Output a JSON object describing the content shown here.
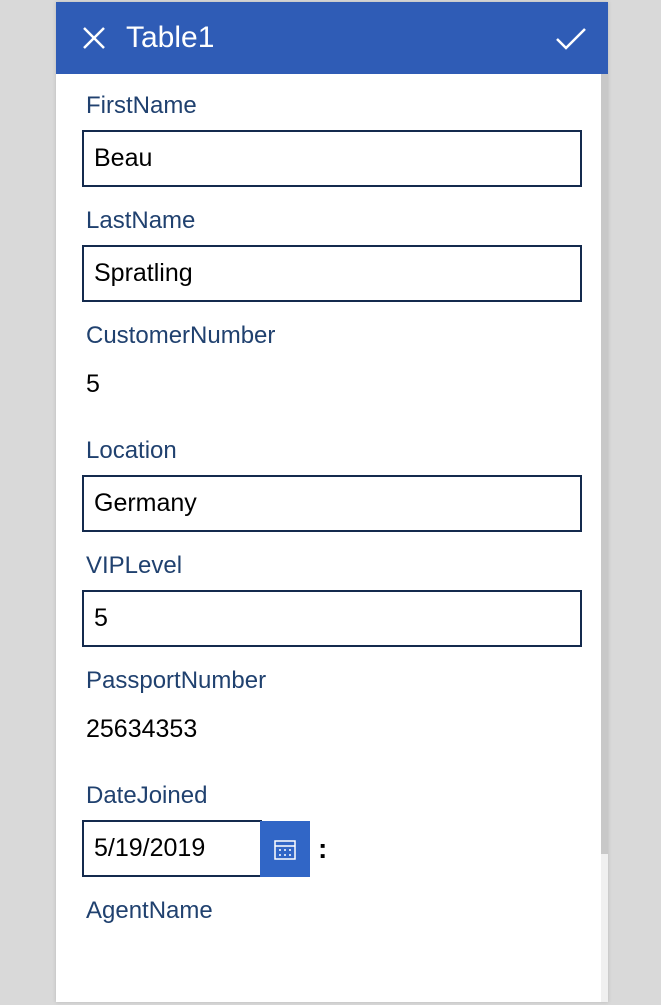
{
  "header": {
    "title": "Table1"
  },
  "form": {
    "firstName": {
      "label": "FirstName",
      "value": "Beau"
    },
    "lastName": {
      "label": "LastName",
      "value": "Spratling"
    },
    "customerNumber": {
      "label": "CustomerNumber",
      "value": "5"
    },
    "location": {
      "label": "Location",
      "value": "Germany"
    },
    "vipLevel": {
      "label": "VIPLevel",
      "value": "5"
    },
    "passportNumber": {
      "label": "PassportNumber",
      "value": "25634353"
    },
    "dateJoined": {
      "label": "DateJoined",
      "value": "5/19/2019",
      "separator": ":"
    },
    "agentName": {
      "label": "AgentName"
    }
  }
}
